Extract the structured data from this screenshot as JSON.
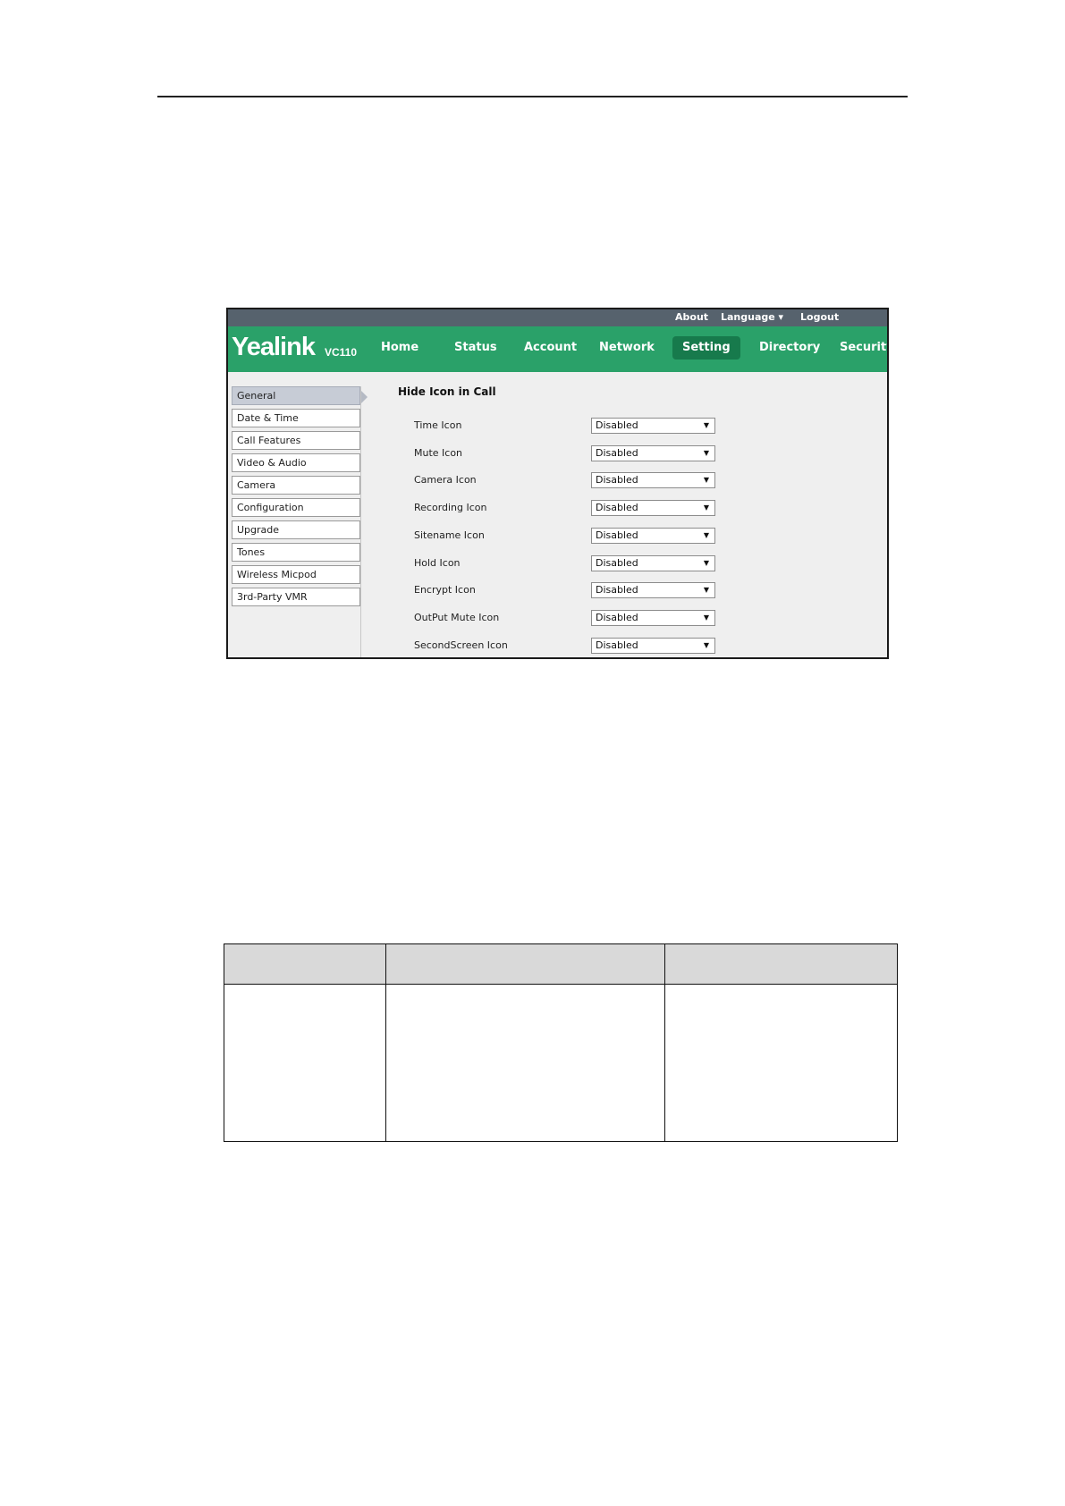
{
  "topbar": {
    "about": "About",
    "language": "Language ▾",
    "logout": "Logout"
  },
  "brand": {
    "name": "Yealink",
    "model": "VC110"
  },
  "nav": [
    "Home",
    "Status",
    "Account",
    "Network",
    "Setting",
    "Directory",
    "Security"
  ],
  "active_nav": "Setting",
  "sidebar": [
    "General",
    "Date & Time",
    "Call Features",
    "Video & Audio",
    "Camera",
    "Configuration",
    "Upgrade",
    "Tones",
    "Wireless Micpod",
    "3rd-Party VMR"
  ],
  "active_sidebar": "General",
  "section_title": "Hide Icon in Call",
  "fields": [
    {
      "label": "Time Icon",
      "value": "Disabled"
    },
    {
      "label": "Mute Icon",
      "value": "Disabled"
    },
    {
      "label": "Camera Icon",
      "value": "Disabled"
    },
    {
      "label": "Recording Icon",
      "value": "Disabled"
    },
    {
      "label": "Sitename Icon",
      "value": "Disabled"
    },
    {
      "label": "Hold Icon",
      "value": "Disabled"
    },
    {
      "label": "Encrypt Icon",
      "value": "Disabled"
    },
    {
      "label": "OutPut Mute Icon",
      "value": "Disabled"
    },
    {
      "label": "SecondScreen Icon",
      "value": "Disabled"
    }
  ],
  "icons": {
    "dropdown": "caret-down-icon",
    "active_marker": "triangle-right-icon"
  }
}
